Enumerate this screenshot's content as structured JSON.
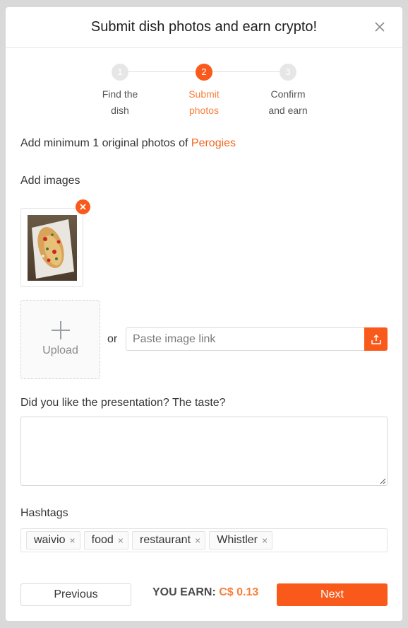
{
  "modal": {
    "title": "Submit dish photos and earn crypto!"
  },
  "steps": [
    {
      "number": "1",
      "label": "Find the\ndish",
      "state": "inactive"
    },
    {
      "number": "2",
      "label": "Submit\nphotos",
      "state": "active"
    },
    {
      "number": "3",
      "label": "Confirm\nand earn",
      "state": "inactive"
    }
  ],
  "intro": {
    "text": "Add minimum 1 original photos of",
    "dish_name": "Perogies"
  },
  "images": {
    "label": "Add images",
    "upload_label": "Upload",
    "or_text": "or",
    "link_placeholder": "Paste image link"
  },
  "review": {
    "label": "Did you like the presentation? The taste?",
    "value": ""
  },
  "hashtags": {
    "label": "Hashtags",
    "tags": [
      "waivio",
      "food",
      "restaurant",
      "Whistler"
    ]
  },
  "footer": {
    "previous_label": "Previous",
    "earn_label": "YOU EARN:",
    "earn_value": "C$ 0.13",
    "next_label": "Next"
  },
  "colors": {
    "accent": "#f95a1b",
    "accent_text": "#f97f3a",
    "step_inactive": "#e6e6e6"
  },
  "icons": {
    "close": "close-icon",
    "remove": "remove-image-icon",
    "upload": "plus-icon",
    "link_upload": "upload-icon"
  }
}
